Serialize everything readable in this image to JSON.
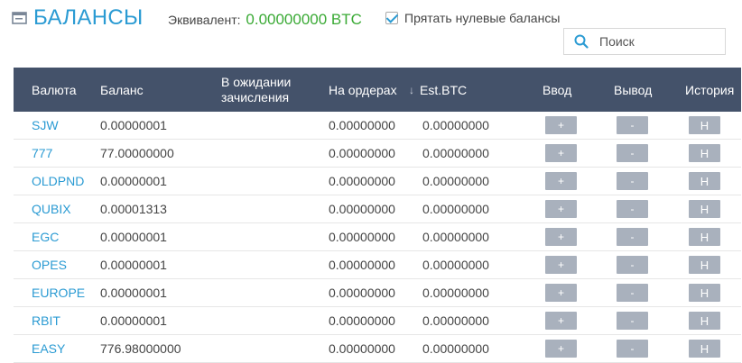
{
  "header": {
    "title": "БАЛАНСЫ",
    "equiv_label": "Эквивалент:",
    "equiv_value": "0.00000000 BTC",
    "hide_zero_label": "Прятать нулевые балансы",
    "hide_zero_checked": true,
    "search_placeholder": "Поиск"
  },
  "table": {
    "columns": {
      "currency": "Валюта",
      "balance": "Баланс",
      "pending": "В ожидании зачисления",
      "on_orders": "На ордерах",
      "est_btc": "Est.BTC",
      "deposit": "Ввод",
      "withdraw": "Вывод",
      "history": "История"
    },
    "rows": [
      {
        "currency": "SJW",
        "balance": "0.00000001",
        "on_orders": "0.00000000",
        "est_btc": "0.00000000",
        "deposit": "+",
        "withdraw": "-",
        "history": "H"
      },
      {
        "currency": "777",
        "balance": "77.00000000",
        "on_orders": "0.00000000",
        "est_btc": "0.00000000",
        "deposit": "+",
        "withdraw": "-",
        "history": "H"
      },
      {
        "currency": "OLDPND",
        "balance": "0.00000001",
        "on_orders": "0.00000000",
        "est_btc": "0.00000000",
        "deposit": "+",
        "withdraw": "-",
        "history": "H"
      },
      {
        "currency": "QUBIX",
        "balance": "0.00001313",
        "on_orders": "0.00000000",
        "est_btc": "0.00000000",
        "deposit": "+",
        "withdraw": "-",
        "history": "H"
      },
      {
        "currency": "EGC",
        "balance": "0.00000001",
        "on_orders": "0.00000000",
        "est_btc": "0.00000000",
        "deposit": "+",
        "withdraw": "-",
        "history": "H"
      },
      {
        "currency": "OPES",
        "balance": "0.00000001",
        "on_orders": "0.00000000",
        "est_btc": "0.00000000",
        "deposit": "+",
        "withdraw": "-",
        "history": "H"
      },
      {
        "currency": "EUROPE",
        "balance": "0.00000001",
        "on_orders": "0.00000000",
        "est_btc": "0.00000000",
        "deposit": "+",
        "withdraw": "-",
        "history": "H"
      },
      {
        "currency": "RBIT",
        "balance": "0.00000001",
        "on_orders": "0.00000000",
        "est_btc": "0.00000000",
        "deposit": "+",
        "withdraw": "-",
        "history": "H"
      },
      {
        "currency": "EASY",
        "balance": "776.98000000",
        "on_orders": "0.00000000",
        "est_btc": "0.00000000",
        "deposit": "+",
        "withdraw": "-",
        "history": "H"
      }
    ]
  },
  "icons": {
    "title_icon": "wallet-icon",
    "search_icon": "search-icon",
    "sort_icon": "sort-down-icon"
  },
  "colors": {
    "accent": "#2b9bd3",
    "equiv_value": "#3aaa35",
    "table_header_bg": "#44526a",
    "button_bg": "#a9b1bd"
  }
}
